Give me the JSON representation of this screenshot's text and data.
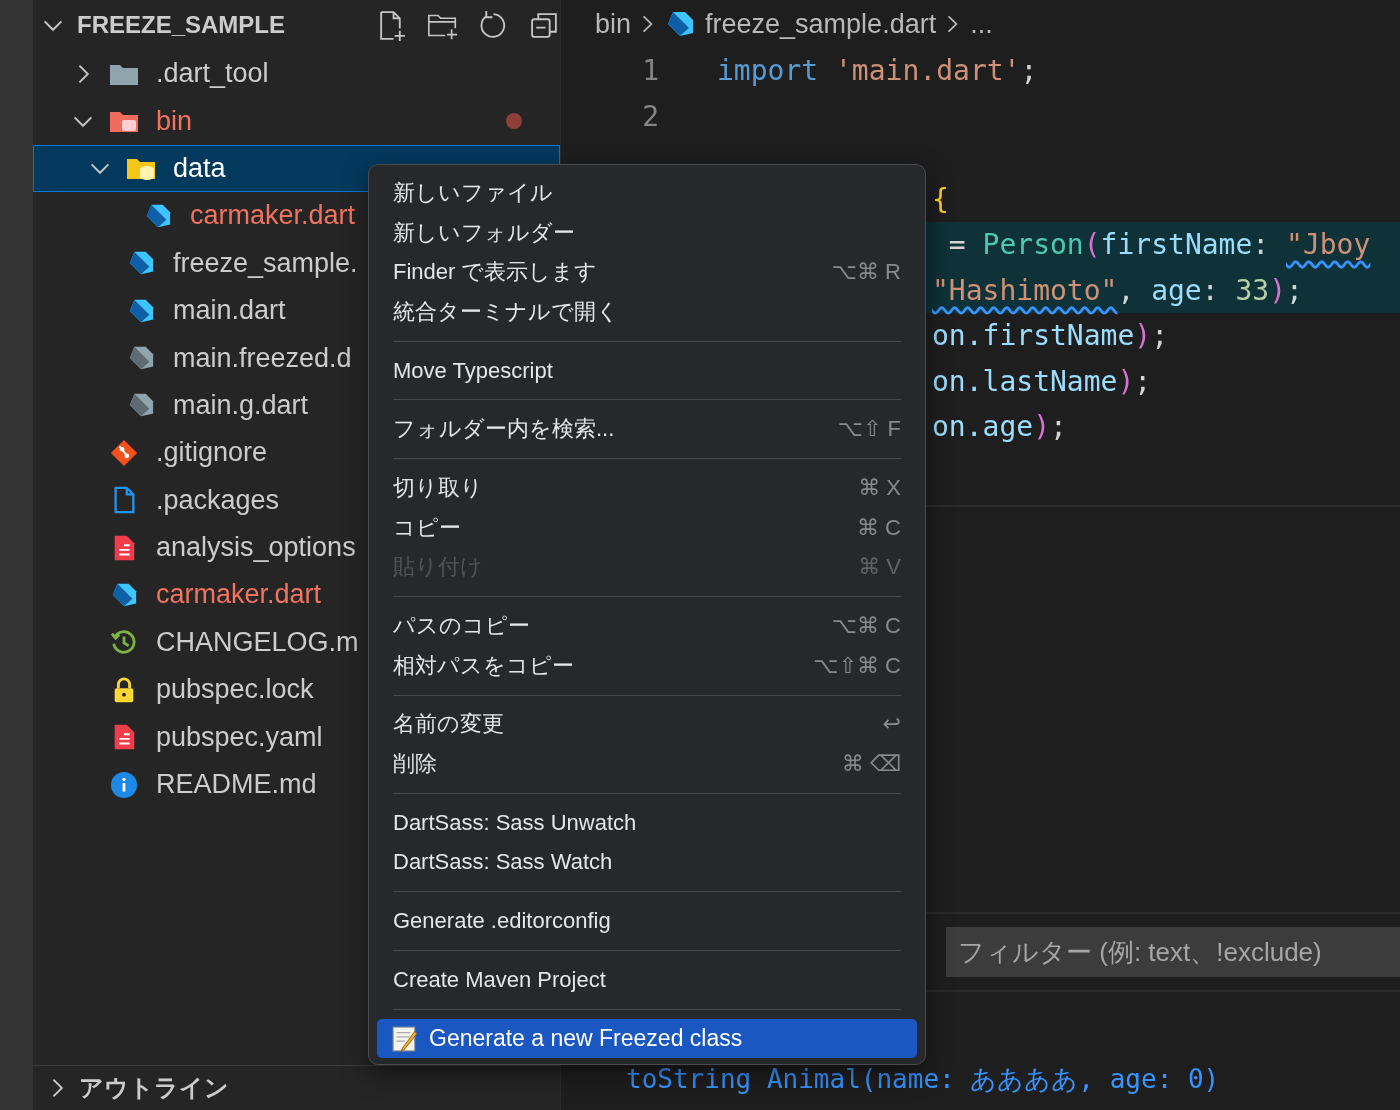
{
  "explorer": {
    "title": "FREEZE_SAMPLE",
    "expanded": true,
    "tree": [
      {
        "name": ".dart_tool",
        "kind": "folder",
        "expanded": false,
        "selected": false,
        "modified": false
      },
      {
        "name": "bin",
        "kind": "folder-bin",
        "expanded": true,
        "selected": false,
        "modified": true,
        "dot": true,
        "children": [
          {
            "name": "data",
            "kind": "folder-data",
            "expanded": true,
            "selected": true,
            "modified": false,
            "children": [
              {
                "name": "carmaker.dart",
                "kind": "dart",
                "selected": false,
                "modified": true
              }
            ]
          },
          {
            "name": "freeze_sample.",
            "kind": "dart",
            "selected": false,
            "modified": false
          },
          {
            "name": "main.dart",
            "kind": "dart",
            "selected": false,
            "modified": false
          },
          {
            "name": "main.freezed.d",
            "kind": "dart-generated",
            "selected": false,
            "modified": false
          },
          {
            "name": "main.g.dart",
            "kind": "dart-generated",
            "selected": false,
            "modified": false
          }
        ]
      },
      {
        "name": ".gitignore",
        "kind": "git",
        "selected": false,
        "modified": false
      },
      {
        "name": ".packages",
        "kind": "file",
        "selected": false,
        "modified": false
      },
      {
        "name": "analysis_options",
        "kind": "yaml",
        "selected": false,
        "modified": false
      },
      {
        "name": "carmaker.dart",
        "kind": "dart",
        "selected": false,
        "modified": true
      },
      {
        "name": "CHANGELOG.m",
        "kind": "history",
        "selected": false,
        "modified": false
      },
      {
        "name": "pubspec.lock",
        "kind": "lock",
        "selected": false,
        "modified": false
      },
      {
        "name": "pubspec.yaml",
        "kind": "yaml",
        "selected": false,
        "modified": false
      },
      {
        "name": "README.md",
        "kind": "info",
        "selected": false,
        "modified": false
      }
    ],
    "outline": {
      "title": "アウトライン",
      "expanded": false
    }
  },
  "breadcrumb": [
    "bin",
    "freeze_sample.dart",
    "..."
  ],
  "editor": {
    "lines": [
      {
        "number": "1",
        "tokens": [
          {
            "text": "import ",
            "kind": "keyword"
          },
          {
            "text": "'main.dart'",
            "kind": "string"
          },
          {
            "text": ";",
            "kind": "punct"
          }
        ]
      },
      {
        "number": "2"
      },
      {
        "highlighted": false,
        "tokens": [
          {
            "text": "{",
            "kind": "brace"
          }
        ]
      },
      {
        "highlighted": true,
        "tokens": [
          {
            "text": " = ",
            "kind": "punct"
          },
          {
            "text": "Person",
            "kind": "class"
          },
          {
            "text": "(",
            "kind": "paren"
          },
          {
            "text": "firstName",
            "kind": "property"
          },
          {
            "text": ": ",
            "kind": "punct"
          },
          {
            "text": "\"Jboy",
            "kind": "string",
            "squiggle": true
          }
        ]
      },
      {
        "highlighted": true,
        "tokens": [
          {
            "text": "\"Hashimoto\"",
            "kind": "string",
            "squiggle": true
          },
          {
            "text": ", ",
            "kind": "punct"
          },
          {
            "text": "age",
            "kind": "property"
          },
          {
            "text": ": ",
            "kind": "punct"
          },
          {
            "text": "33",
            "kind": "number"
          },
          {
            "text": ")",
            "kind": "paren"
          },
          {
            "text": ";",
            "kind": "punct"
          }
        ]
      },
      {
        "highlighted": false,
        "tokens": [
          {
            "text": "on.",
            "kind": "property"
          },
          {
            "text": "firstName",
            "kind": "property"
          },
          {
            "text": ")",
            "kind": "paren"
          },
          {
            "text": ";",
            "kind": "punct"
          }
        ]
      },
      {
        "highlighted": false,
        "tokens": [
          {
            "text": "on.",
            "kind": "property"
          },
          {
            "text": "lastName",
            "kind": "property"
          },
          {
            "text": ")",
            "kind": "paren"
          },
          {
            "text": ";",
            "kind": "punct"
          }
        ]
      },
      {
        "highlighted": false,
        "tokens": [
          {
            "text": "on.",
            "kind": "property"
          },
          {
            "text": "age",
            "kind": "property"
          },
          {
            "text": ")",
            "kind": "paren"
          },
          {
            "text": ";",
            "kind": "punct"
          }
        ]
      }
    ]
  },
  "panel": {
    "filter": {
      "placeholder": "フィルター (例: text、!exclude)"
    },
    "output": [
      "toString Animal(name: ああああ, age: 0)"
    ]
  },
  "context_menu": {
    "groups": [
      [
        {
          "label": "新しいファイル",
          "selected": false
        },
        {
          "label": "新しいフォルダー",
          "selected": false
        },
        {
          "label": "Finder で表示します",
          "shortcut": "⌥⌘ R",
          "selected": false
        },
        {
          "label": "統合ターミナルで開く",
          "selected": false
        }
      ],
      [
        {
          "label": "Move Typescript",
          "selected": false
        }
      ],
      [
        {
          "label": "フォルダー内を検索...",
          "shortcut": "⌥⇧ F",
          "selected": false
        }
      ],
      [
        {
          "label": "切り取り",
          "shortcut": "⌘ X",
          "selected": false
        },
        {
          "label": "コピー",
          "shortcut": "⌘ C",
          "selected": false
        },
        {
          "label": "貼り付け",
          "shortcut": "⌘ V",
          "disabled": true,
          "selected": false
        }
      ],
      [
        {
          "label": "パスのコピー",
          "shortcut": "⌥⌘ C",
          "selected": false
        },
        {
          "label": "相対パスをコピー",
          "shortcut": "⌥⇧⌘ C",
          "selected": false
        }
      ],
      [
        {
          "label": "名前の変更",
          "shortcut": "↩",
          "selected": false
        },
        {
          "label": "削除",
          "shortcut": "⌘ ⌫",
          "selected": false
        }
      ],
      [
        {
          "label": "DartSass: Sass Unwatch",
          "selected": false
        },
        {
          "label": "DartSass: Sass Watch",
          "selected": false
        }
      ],
      [
        {
          "label": "Generate .editorconfig",
          "selected": false
        }
      ],
      [
        {
          "label": "Create Maven Project",
          "selected": false
        }
      ],
      [
        {
          "label": "Generate a new Freezed class",
          "selected": true
        }
      ]
    ]
  }
}
